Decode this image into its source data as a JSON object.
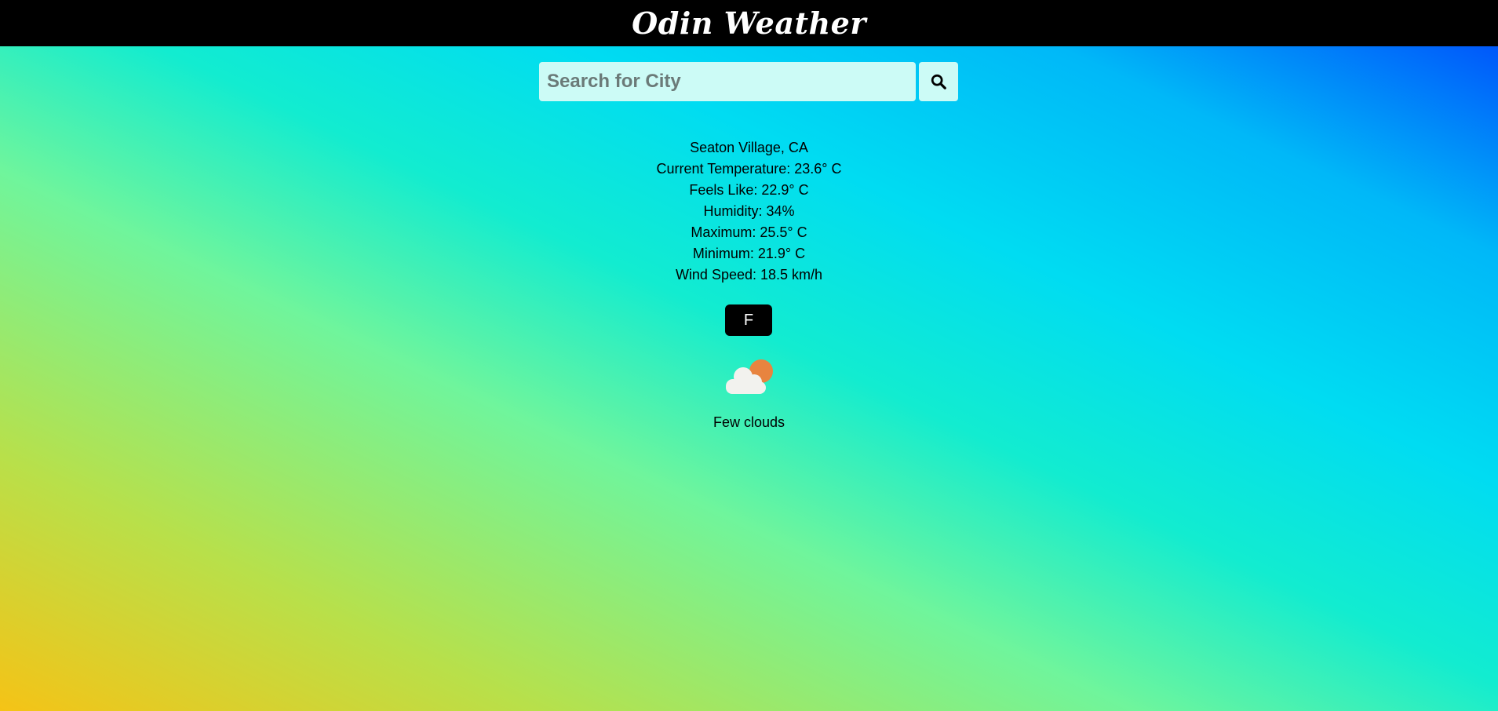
{
  "header": {
    "title": "Odin Weather"
  },
  "search": {
    "placeholder": "Search for City",
    "value": "",
    "button_icon": "search-icon"
  },
  "weather": {
    "location": "Seaton Village, CA",
    "current_temperature": "Current Temperature: 23.6° C",
    "feels_like": "Feels Like: 22.9° C",
    "humidity": "Humidity: 34%",
    "maximum": "Maximum: 25.5° C",
    "minimum": "Minimum: 21.9° C",
    "wind_speed": "Wind Speed: 18.5 km/h",
    "icon": "few-clouds-icon",
    "description": "Few clouds"
  },
  "unit_toggle": {
    "label": "F"
  },
  "colors": {
    "header_bg": "#000000",
    "input_bg": "#ccfbf6",
    "button_bg": "#000000",
    "sun": "#e8843f",
    "cloud": "#f2f2ee",
    "gradient": [
      "#f5c316",
      "#6ff59c",
      "#12ecd0",
      "#00dcf2",
      "#0042fb"
    ]
  }
}
